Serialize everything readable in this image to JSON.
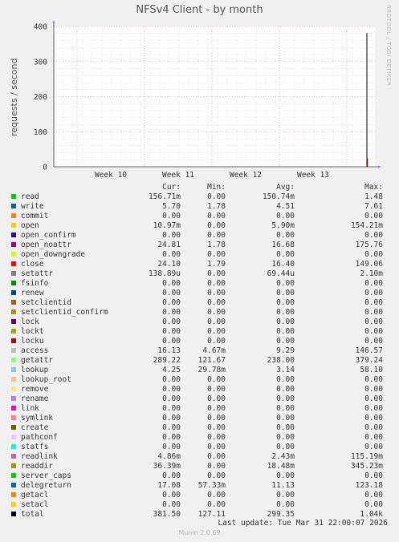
{
  "header": {
    "title": "NFSv4 Client - by month",
    "side_text": "RRDTOOL / TOBI OETIKER"
  },
  "chart_data": {
    "type": "line",
    "title": "NFSv4 Client - by month",
    "ylabel": "requests / second",
    "ylim": [
      0,
      400
    ],
    "yticks": [
      0,
      100,
      200,
      300,
      400
    ],
    "x_ticks": [
      "Week 10",
      "Week 11",
      "Week 12",
      "Week 13"
    ],
    "grid": true,
    "series": [
      {
        "name": "total",
        "color": "#000000",
        "points": [
          [
            0.975,
            0
          ],
          [
            0.975,
            381.5
          ],
          [
            0.975,
            220
          ]
        ]
      },
      {
        "name": "getattr",
        "color": "#ccff99",
        "points": [
          [
            0.975,
            0
          ],
          [
            0.975,
            220
          ]
        ]
      },
      {
        "name": "close",
        "color": "#ff0000",
        "points": [
          [
            0.977,
            0
          ],
          [
            0.977,
            24
          ]
        ]
      }
    ]
  },
  "legend": {
    "headers": {
      "cur": "Cur:",
      "min": "Min:",
      "avg": "Avg:",
      "max": "Max:"
    },
    "rows": [
      {
        "name": "read",
        "color": "#00cc00",
        "cur": "156.71m",
        "min": "0.00",
        "avg": "150.74m",
        "max": "1.48"
      },
      {
        "name": "write",
        "color": "#0066b3",
        "cur": "5.70",
        "min": "1.78",
        "avg": "4.51",
        "max": "7.61"
      },
      {
        "name": "commit",
        "color": "#ff8000",
        "cur": "0.00",
        "min": "0.00",
        "avg": "0.00",
        "max": "0.00"
      },
      {
        "name": "open",
        "color": "#ffcc00",
        "cur": "10.97m",
        "min": "0.00",
        "avg": "5.90m",
        "max": "154.21m"
      },
      {
        "name": "open_confirm",
        "color": "#330099",
        "cur": "0.00",
        "min": "0.00",
        "avg": "0.00",
        "max": "0.00"
      },
      {
        "name": "open_noattr",
        "color": "#990099",
        "cur": "24.81",
        "min": "1.78",
        "avg": "16.68",
        "max": "175.76"
      },
      {
        "name": "open_downgrade",
        "color": "#ccff00",
        "cur": "0.00",
        "min": "0.00",
        "avg": "0.00",
        "max": "0.00"
      },
      {
        "name": "close",
        "color": "#ff0000",
        "cur": "24.10",
        "min": "1.79",
        "avg": "16.40",
        "max": "149.06"
      },
      {
        "name": "setattr",
        "color": "#808080",
        "cur": "138.89u",
        "min": "0.00",
        "avg": "69.44u",
        "max": "2.10m"
      },
      {
        "name": "fsinfo",
        "color": "#008f00",
        "cur": "0.00",
        "min": "0.00",
        "avg": "0.00",
        "max": "0.00"
      },
      {
        "name": "renew",
        "color": "#00487d",
        "cur": "0.00",
        "min": "0.00",
        "avg": "0.00",
        "max": "0.00"
      },
      {
        "name": "setclientid",
        "color": "#b35a00",
        "cur": "0.00",
        "min": "0.00",
        "avg": "0.00",
        "max": "0.00"
      },
      {
        "name": "setclientid_confirm",
        "color": "#b38f00",
        "cur": "0.00",
        "min": "0.00",
        "avg": "0.00",
        "max": "0.00"
      },
      {
        "name": "lock",
        "color": "#6b006b",
        "cur": "0.00",
        "min": "0.00",
        "avg": "0.00",
        "max": "0.00"
      },
      {
        "name": "lockt",
        "color": "#8fb300",
        "cur": "0.00",
        "min": "0.00",
        "avg": "0.00",
        "max": "0.00"
      },
      {
        "name": "locku",
        "color": "#b30000",
        "cur": "0.00",
        "min": "0.00",
        "avg": "0.00",
        "max": "0.00"
      },
      {
        "name": "access",
        "color": "#bebebe",
        "cur": "16.13",
        "min": "4.67m",
        "avg": "9.29",
        "max": "146.57"
      },
      {
        "name": "getattr",
        "color": "#80ff80",
        "cur": "289.22",
        "min": "121.67",
        "avg": "238.00",
        "max": "379.24"
      },
      {
        "name": "lookup",
        "color": "#80c9ff",
        "cur": "4.25",
        "min": "29.78m",
        "avg": "3.14",
        "max": "58.10"
      },
      {
        "name": "lookup_root",
        "color": "#ffc080",
        "cur": "0.00",
        "min": "0.00",
        "avg": "0.00",
        "max": "0.00"
      },
      {
        "name": "remove",
        "color": "#ffe680",
        "cur": "0.00",
        "min": "0.00",
        "avg": "0.00",
        "max": "0.00"
      },
      {
        "name": "rename",
        "color": "#aa80ff",
        "cur": "0.00",
        "min": "0.00",
        "avg": "0.00",
        "max": "0.00"
      },
      {
        "name": "link",
        "color": "#ee00cc",
        "cur": "0.00",
        "min": "0.00",
        "avg": "0.00",
        "max": "0.00"
      },
      {
        "name": "symlink",
        "color": "#ff8080",
        "cur": "0.00",
        "min": "0.00",
        "avg": "0.00",
        "max": "0.00"
      },
      {
        "name": "create",
        "color": "#666600",
        "cur": "0.00",
        "min": "0.00",
        "avg": "0.00",
        "max": "0.00"
      },
      {
        "name": "pathconf",
        "color": "#ffbfff",
        "cur": "0.00",
        "min": "0.00",
        "avg": "0.00",
        "max": "0.00"
      },
      {
        "name": "statfs",
        "color": "#00ffcc",
        "cur": "0.00",
        "min": "0.00",
        "avg": "0.00",
        "max": "0.00"
      },
      {
        "name": "readlink",
        "color": "#cc6699",
        "cur": "4.86m",
        "min": "0.00",
        "avg": "2.43m",
        "max": "115.19m"
      },
      {
        "name": "readdir",
        "color": "#999900",
        "cur": "36.39m",
        "min": "0.00",
        "avg": "18.48m",
        "max": "345.23m"
      },
      {
        "name": "server_caps",
        "color": "#00cc00",
        "cur": "0.00",
        "min": "0.00",
        "avg": "0.00",
        "max": "0.00"
      },
      {
        "name": "delegreturn",
        "color": "#0066b3",
        "cur": "17.08",
        "min": "57.33m",
        "avg": "11.13",
        "max": "123.18"
      },
      {
        "name": "getacl",
        "color": "#ff8000",
        "cur": "0.00",
        "min": "0.00",
        "avg": "0.00",
        "max": "0.00"
      },
      {
        "name": "setacl",
        "color": "#ffcc00",
        "cur": "0.00",
        "min": "0.00",
        "avg": "0.00",
        "max": "0.00"
      },
      {
        "name": "total",
        "color": "#000000",
        "cur": "381.50",
        "min": "127.11",
        "avg": "299.35",
        "max": "1.04k"
      }
    ]
  },
  "footer": {
    "last_update": "Last update: Tue Mar 31 22:00:07 2026",
    "munin": "Munin 2.0.69"
  }
}
